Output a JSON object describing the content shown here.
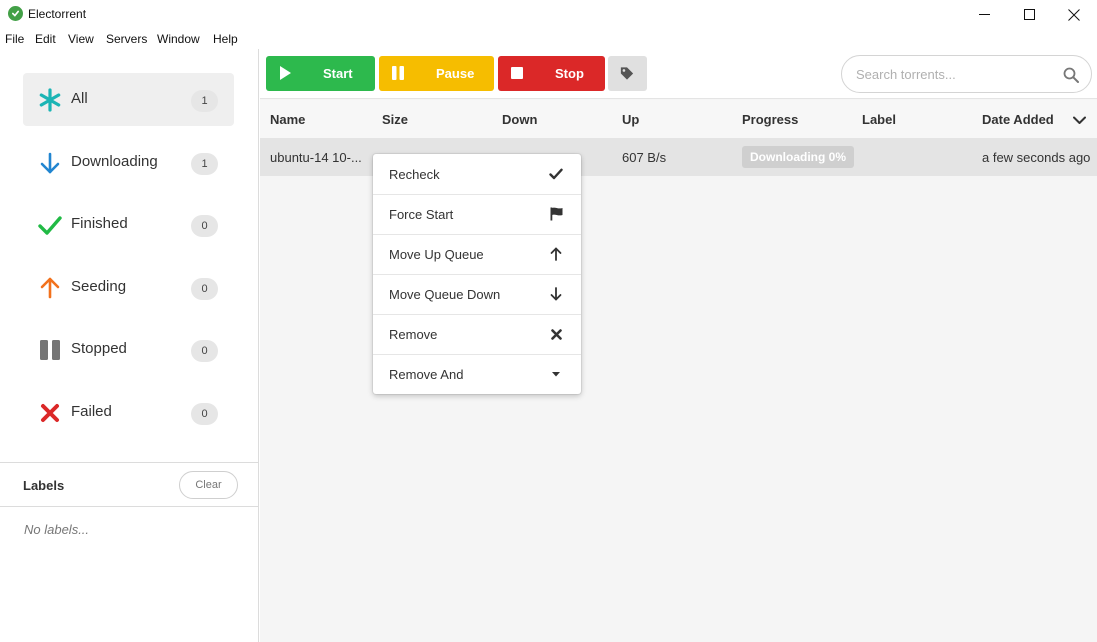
{
  "window": {
    "title": "Electorrent"
  },
  "menu": [
    "File",
    "Edit",
    "View",
    "Servers",
    "Window",
    "Help"
  ],
  "sidebar": {
    "filters": [
      {
        "label": "All",
        "count": "1",
        "icon": "asterisk-icon",
        "color": "#1bb5b5",
        "active": true
      },
      {
        "label": "Downloading",
        "count": "1",
        "icon": "arrow-down-icon",
        "color": "#2185d0"
      },
      {
        "label": "Finished",
        "count": "0",
        "icon": "check-icon",
        "color": "#21ba45"
      },
      {
        "label": "Seeding",
        "count": "0",
        "icon": "arrow-up-icon",
        "color": "#f2711c"
      },
      {
        "label": "Stopped",
        "count": "0",
        "icon": "pause-icon",
        "color": "#767676"
      },
      {
        "label": "Failed",
        "count": "0",
        "icon": "x-icon",
        "color": "#db2828"
      }
    ],
    "labels": {
      "title": "Labels",
      "clear": "Clear",
      "empty": "No labels..."
    }
  },
  "toolbar": {
    "start": "Start",
    "pause": "Pause",
    "stop": "Stop",
    "colors": {
      "start": "#2db94d",
      "pause": "#f6bd00",
      "stop": "#db2828"
    }
  },
  "search": {
    "placeholder": "Search torrents..."
  },
  "table": {
    "columns": [
      "Name",
      "Size",
      "Down",
      "Up",
      "Progress",
      "Label",
      "Date Added"
    ],
    "rows": [
      {
        "name": "ubuntu-14 10-...",
        "size": "",
        "down": "",
        "up": "607 B/s",
        "progress": "Downloading 0%",
        "progress_value": 0,
        "label": "",
        "date_added": "a few seconds ago"
      }
    ]
  },
  "context_menu": [
    {
      "label": "Recheck",
      "icon": "check-icon"
    },
    {
      "label": "Force Start",
      "icon": "flag-icon"
    },
    {
      "label": "Move Up Queue",
      "icon": "arrow-up-icon"
    },
    {
      "label": "Move Queue Down",
      "icon": "arrow-down-icon"
    },
    {
      "label": "Remove",
      "icon": "x-icon"
    },
    {
      "label": "Remove And",
      "icon": "caret-down-icon"
    }
  ]
}
